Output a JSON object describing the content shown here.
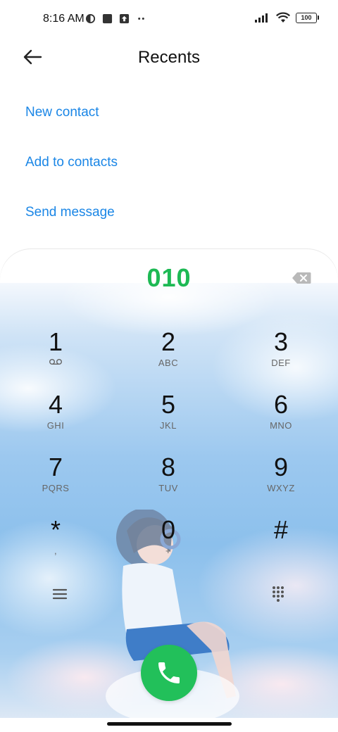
{
  "status_bar": {
    "time": "8:16 AM",
    "battery": "100",
    "left_icons": [
      "timer-icon",
      "square-icon",
      "upload-icon",
      "more-dots-icon"
    ],
    "right_icons": [
      "signal-icon",
      "wifi-icon",
      "battery-icon"
    ]
  },
  "header": {
    "title": "Recents",
    "back_icon": "back-arrow-icon"
  },
  "actions": {
    "new_contact": "New contact",
    "add_to_contacts": "Add to contacts",
    "send_message": "Send message"
  },
  "dialer": {
    "number": "010",
    "keys": [
      {
        "digit": "1",
        "letters": ""
      },
      {
        "digit": "2",
        "letters": "ABC"
      },
      {
        "digit": "3",
        "letters": "DEF"
      },
      {
        "digit": "4",
        "letters": "GHI"
      },
      {
        "digit": "5",
        "letters": "JKL"
      },
      {
        "digit": "6",
        "letters": "MNO"
      },
      {
        "digit": "7",
        "letters": "PQRS"
      },
      {
        "digit": "8",
        "letters": "TUV"
      },
      {
        "digit": "9",
        "letters": "WXYZ"
      },
      {
        "digit": "*",
        "letters": ","
      },
      {
        "digit": "0",
        "letters": "+"
      },
      {
        "digit": "#",
        "letters": ""
      }
    ],
    "accent_color": "#1db954",
    "call_color": "#22c05a",
    "link_color": "#1a86e6"
  }
}
